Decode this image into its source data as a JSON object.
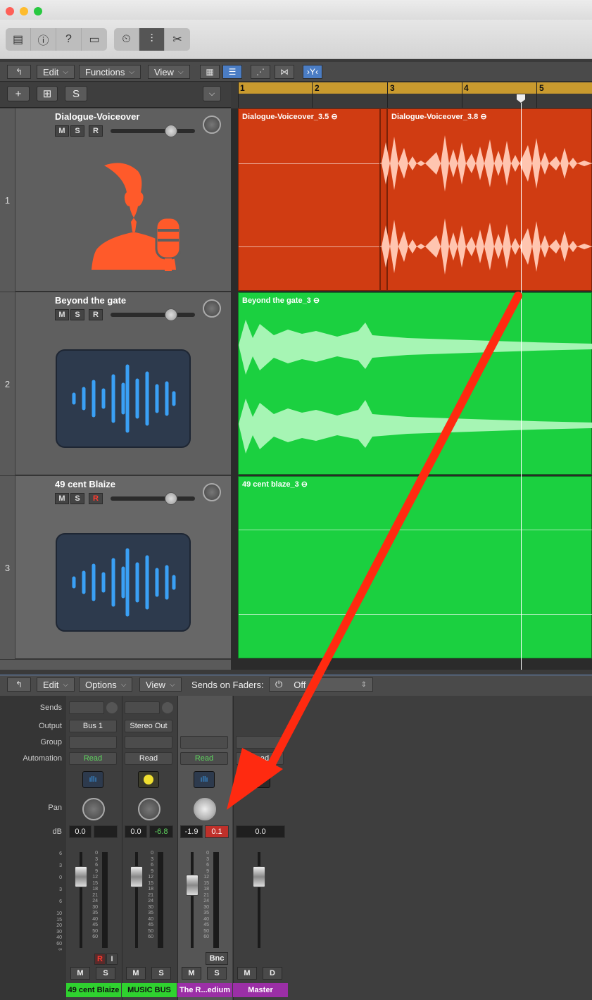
{
  "colors": {
    "vo_region": "#d03c12",
    "music_region": "#1bd040",
    "playhead": "#ffffff",
    "arrow": "#ff2a10",
    "mixer_green": "#2fd22f",
    "mixer_purple": "#9b2fa6"
  },
  "toolbar": {
    "icons": [
      "library-icon",
      "info-icon",
      "help-icon",
      "editors-icon",
      "tuner-icon",
      "mixer-toggle-icon",
      "scissors-icon"
    ]
  },
  "editbar": {
    "back_icon": "⤴",
    "edit": "Edit",
    "functions": "Function​s",
    "view": "View"
  },
  "trackhdr": {
    "add": "+",
    "add_folder": "⊞",
    "solo": "S"
  },
  "ruler": {
    "bars": [
      "1",
      "2",
      "3",
      "4",
      "5"
    ]
  },
  "tracks": [
    {
      "number": "1",
      "name": "Dialogue-Voiceover",
      "m": "M",
      "s": "S",
      "r": "R"
    },
    {
      "number": "2",
      "name": "Beyond the gate",
      "m": "M",
      "s": "S",
      "r": "R"
    },
    {
      "number": "3",
      "name": "49 cent Blaize",
      "m": "M",
      "s": "S",
      "r": "R"
    }
  ],
  "regions": {
    "vo1": "Dialogue-Voiceover_3.5",
    "vo2": "Dialogue-Voiceover_3.8",
    "music1": "Beyond the gate_3",
    "music2": "49 cent blaze_3"
  },
  "mixbar": {
    "edit": "Edit",
    "options": "Options",
    "view": "View",
    "sends_label": "Sends on Faders:",
    "sends_value": "Off"
  },
  "mixer": {
    "labels": {
      "sends": "Sends",
      "output": "Output",
      "group": "Group",
      "automation": "Automation",
      "pan": "Pan",
      "db": "dB"
    },
    "strips": [
      {
        "output": "Bus 1",
        "automation": "Read",
        "db": "0.0",
        "peak": "",
        "name": "49 cent Blaize",
        "m": "M",
        "s": "S",
        "r": "R",
        "i": "I",
        "name_color": "#2fd22f"
      },
      {
        "output": "Stereo Out",
        "automation": "Read",
        "db": "0.0",
        "peak": "-6.8",
        "name": "MUSIC BUS",
        "m": "M",
        "s": "S",
        "name_color": "#2fd22f"
      },
      {
        "output": "",
        "automation": "Read",
        "db": "-1.9",
        "peak": "0.1",
        "name": "The R...edium",
        "m": "M",
        "s": "S",
        "bnc": "Bnc",
        "name_color": "#9b2fa6"
      },
      {
        "output": "",
        "automation": "Read",
        "db": "0.0",
        "name": "Master",
        "m": "M",
        "d": "D",
        "name_color": "#9b2fa6"
      }
    ],
    "scale_left": [
      "6",
      "3",
      "0",
      "3",
      "6",
      "10",
      "15",
      "20",
      "30",
      "40",
      "60",
      "∞"
    ],
    "scale_meter": [
      "0",
      "3",
      "6",
      "9",
      "12",
      "15",
      "18",
      "21",
      "24",
      "30",
      "35",
      "40",
      "45",
      "50",
      "60"
    ]
  }
}
